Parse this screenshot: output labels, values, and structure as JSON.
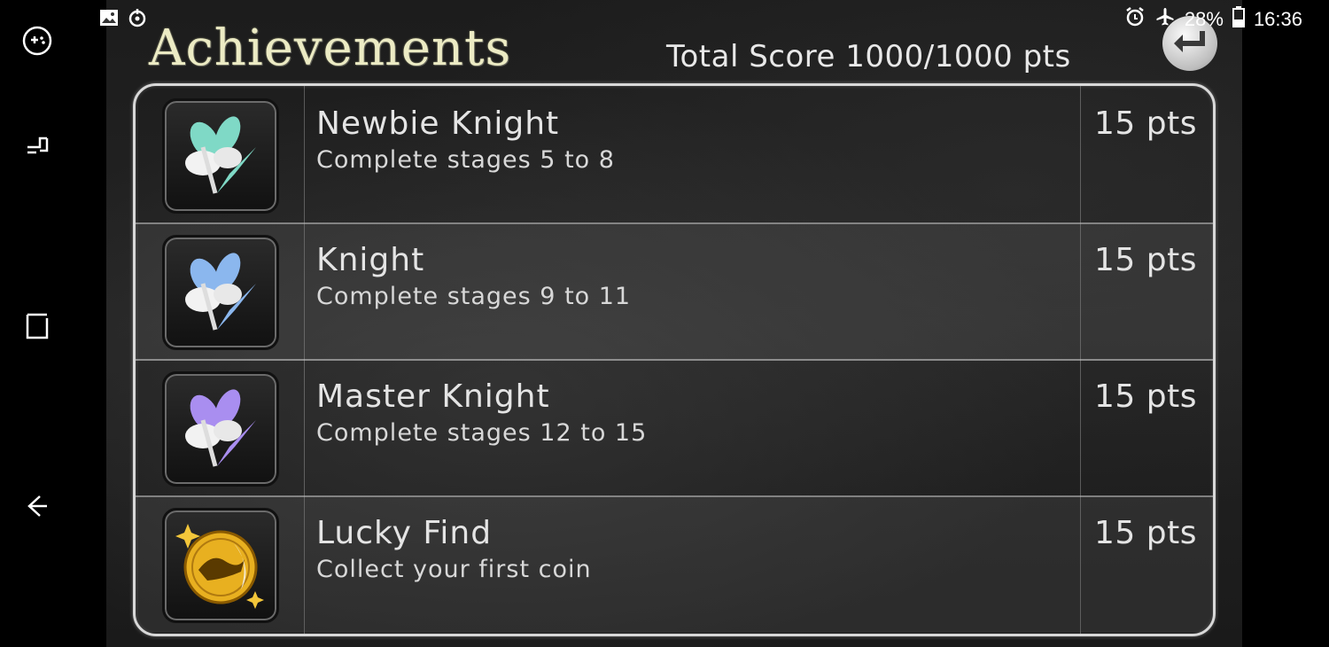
{
  "status_bar": {
    "battery": "28%",
    "time": "16:36",
    "icons": [
      "gallery-icon",
      "sync-icon",
      "alarm-icon",
      "airplane-icon",
      "battery-icon"
    ]
  },
  "nav_bar": {
    "icons": [
      "game-tools-icon",
      "recent-apps-icon",
      "home-icon",
      "back-icon"
    ]
  },
  "screen": {
    "title": "Achievements",
    "total_score": "Total Score 1000/1000 pts"
  },
  "achievements": [
    {
      "name": "Newbie Knight",
      "description": "Complete stages 5 to 8",
      "points": "15 pts",
      "icon": "lily-teal-icon",
      "accent": "#7fd9c6"
    },
    {
      "name": "Knight",
      "description": "Complete stages 9 to 11",
      "points": "15 pts",
      "icon": "lily-blue-icon",
      "accent": "#8bb7ee"
    },
    {
      "name": "Master Knight",
      "description": "Complete stages 12 to 15",
      "points": "15 pts",
      "icon": "lily-purple-icon",
      "accent": "#a98ef0"
    },
    {
      "name": "Lucky Find",
      "description": "Collect your first coin",
      "points": "15 pts",
      "icon": "gold-coin-icon",
      "accent": "#e8b020"
    }
  ]
}
